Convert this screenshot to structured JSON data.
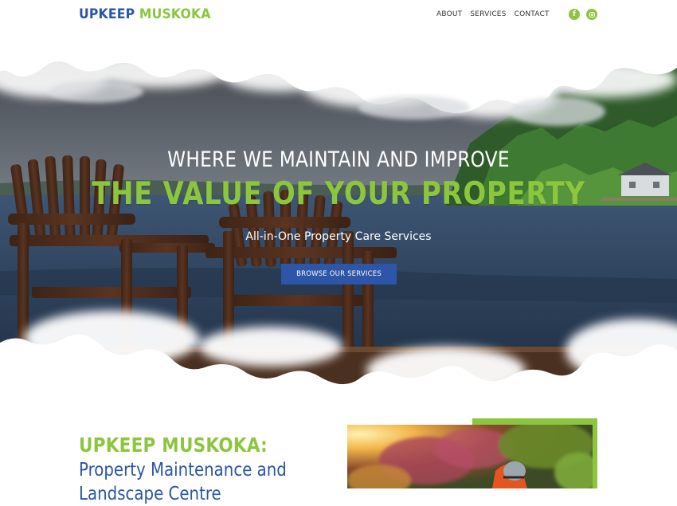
{
  "header": {
    "logo_part1": "UPKEEP",
    "logo_part2": "MUSKOKA",
    "nav": [
      "ABOUT",
      "SERVICES",
      "CONTACT"
    ],
    "social": {
      "facebook_label": "f",
      "icons": [
        "facebook-icon",
        "instagram-icon"
      ]
    }
  },
  "hero": {
    "subtitle": "WHERE WE MAINTAIN AND IMPROVE",
    "title": "THE VALUE OF YOUR PROPERTY",
    "tagline": "All-in-One Property Care Services",
    "button_label": "BROWSE OUR SERVICES"
  },
  "intro": {
    "title": "UPKEEP MUSKOKA:",
    "subtitle": "Property Maintenance and Landscape Centre"
  },
  "colors": {
    "brand_blue": "#2a55a8",
    "brand_green": "#8cc63f",
    "button_blue": "#2d55a8"
  }
}
